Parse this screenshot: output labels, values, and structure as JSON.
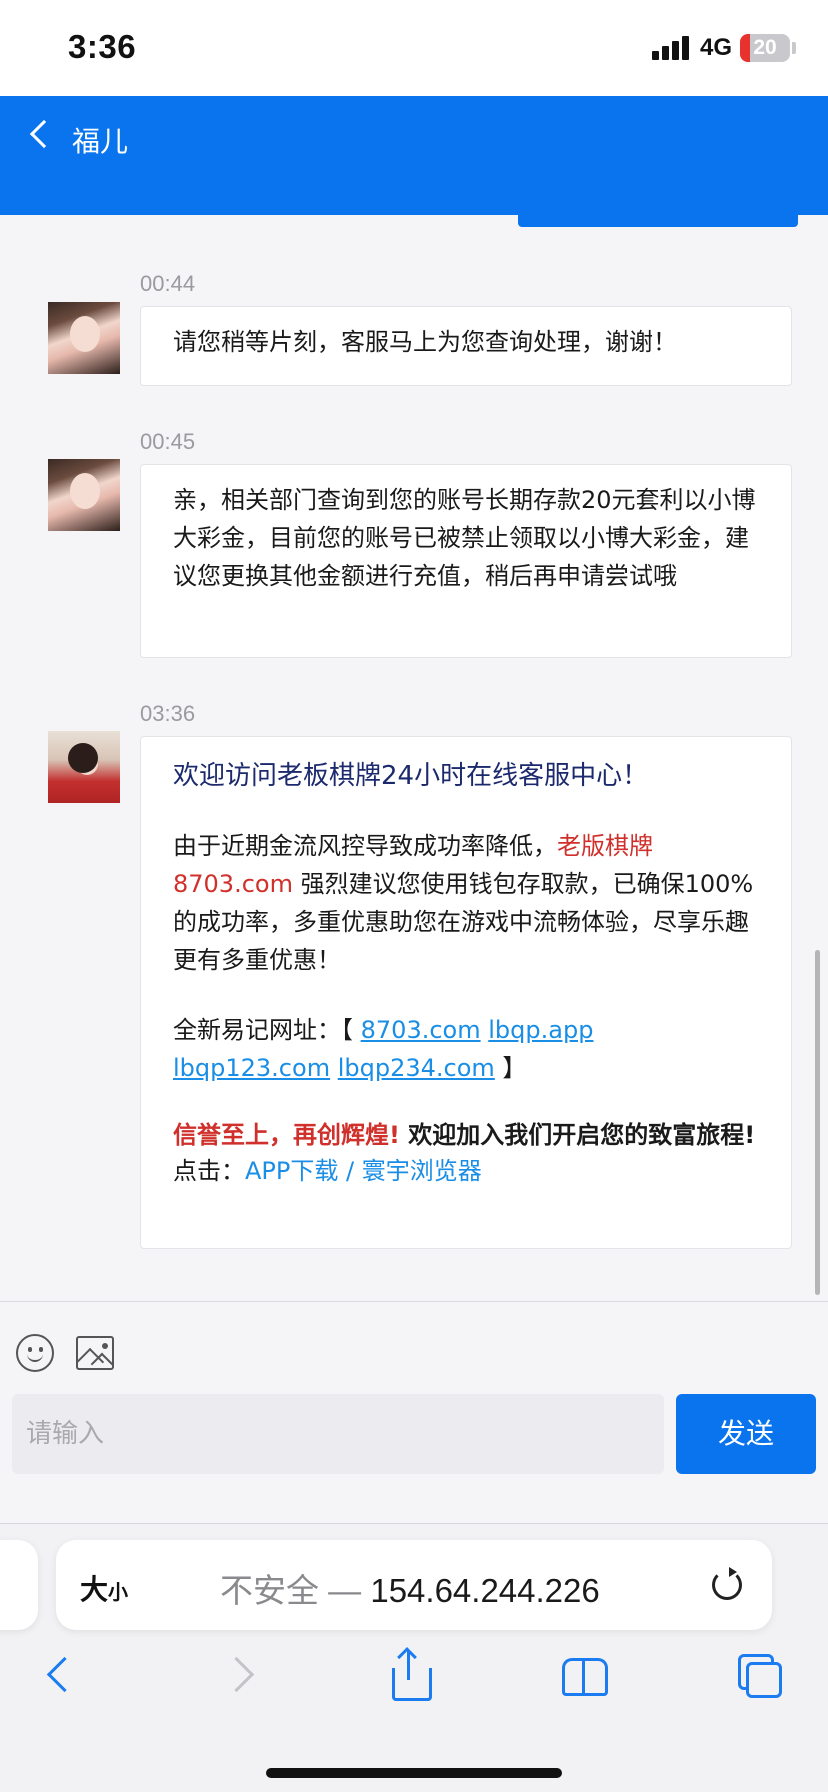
{
  "status_bar": {
    "time": "3:36",
    "network": "4G",
    "battery": "20",
    "battery_color": "#e8322e"
  },
  "header": {
    "title": "福儿",
    "accent": "#0a74ee"
  },
  "messages": [
    {
      "time": "00:44",
      "text": "请您稍等片刻，客服马上为您查询处理，谢谢！"
    },
    {
      "time": "00:45",
      "text": "亲，相关部门查询到您的账号长期存款20元套利以小博大彩金，目前您的账号已被禁止领取以小博大彩金，建议您更换其他金额进行充值，稍后再申请尝试哦"
    },
    {
      "time": "03:36",
      "welcome": "欢迎访问老板棋牌24小时在线客服中心！",
      "para1_a": "由于近期金流风控导致成功率降低，",
      "para1_red": "老版棋牌8703.com",
      "para1_b": " 强烈建议您使用钱包存取款，已确保100%的成功率，多重优惠助您在游戏中流畅体验，尽享乐趣更有多重优惠！",
      "urls_label": "全新易记网址：【 ",
      "urls": [
        "8703.com",
        "lbqp.app",
        "lbqp123.com",
        "lbqp234.com"
      ],
      "urls_close": " 】",
      "slogan_red": "信誉至上，再创辉煌!",
      "slogan_black": " 欢迎加入我们开启您的致富旅程!",
      "click_label": "点击：",
      "click_links": "APP下载 / 寰宇浏览器"
    }
  ],
  "composer": {
    "placeholder": "请输入",
    "send_label": "发送"
  },
  "browser": {
    "text_size_big": "大",
    "text_size_small": "小",
    "insecure_label": "不安全 — ",
    "address": "154.64.244.226",
    "icons": [
      "reload-icon",
      "back-icon",
      "forward-icon",
      "share-icon",
      "bookmarks-icon",
      "tabs-icon"
    ]
  }
}
